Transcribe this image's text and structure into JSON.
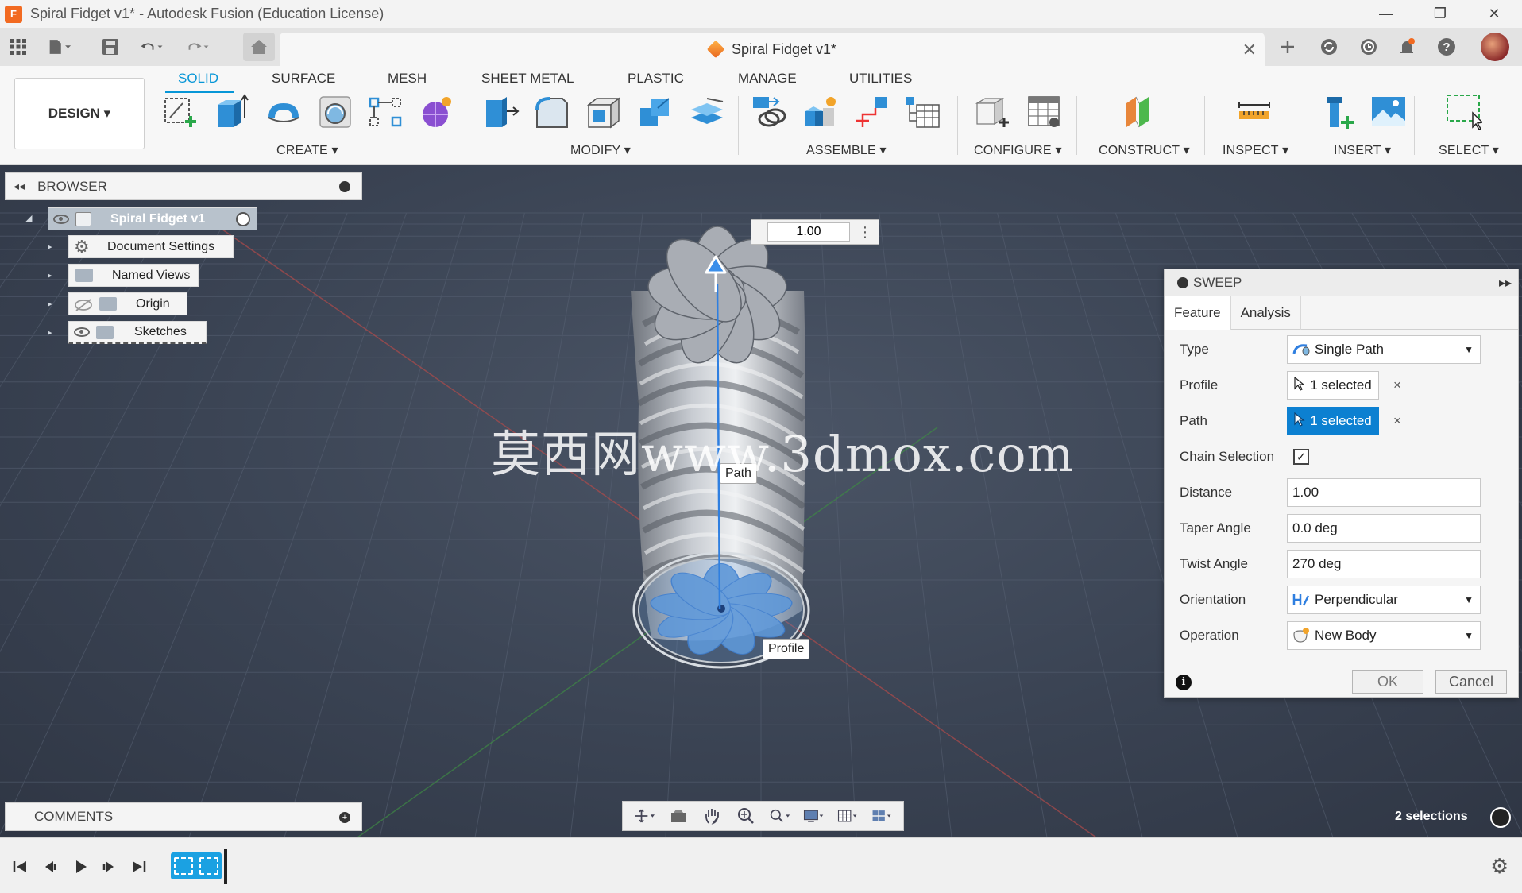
{
  "window": {
    "title": "Spiral Fidget v1* - Autodesk Fusion (Education License)",
    "app_icon": "F",
    "minimize_icon": "—",
    "restore_icon": "❐",
    "close_icon": "✕"
  },
  "doc_tab": {
    "label": "Spiral Fidget v1*",
    "close": "✕"
  },
  "workspace": {
    "label": "DESIGN ▾"
  },
  "ribbon_tabs": [
    "SOLID",
    "SURFACE",
    "MESH",
    "SHEET METAL",
    "PLASTIC",
    "MANAGE",
    "UTILITIES"
  ],
  "ribbon_groups": {
    "create": "CREATE ▾",
    "modify": "MODIFY ▾",
    "assemble": "ASSEMBLE ▾",
    "configure": "CONFIGURE ▾",
    "construct": "CONSTRUCT ▾",
    "inspect": "INSPECT ▾",
    "insert": "INSERT ▾",
    "select": "SELECT ▾"
  },
  "browser": {
    "title": "BROWSER",
    "collapse_icon": "◂◂",
    "root": "Spiral Fidget v1",
    "items": [
      "Document Settings",
      "Named Views",
      "Origin",
      "Sketches"
    ]
  },
  "comments": {
    "title": "COMMENTS",
    "plus": "+"
  },
  "viewport": {
    "dimension_value": "1.00",
    "path_label": "Path",
    "profile_label": "Profile",
    "watermark": "莫西网www.3dmox.com"
  },
  "status": {
    "selections": "2 selections"
  },
  "sweep": {
    "title": "SWEEP",
    "expand_icon": "▸▸",
    "tabs": [
      "Feature",
      "Analysis"
    ],
    "rows": {
      "type": {
        "label": "Type",
        "value": "Single Path"
      },
      "profile": {
        "label": "Profile",
        "value": "1 selected"
      },
      "path": {
        "label": "Path",
        "value": "1 selected"
      },
      "chain": {
        "label": "Chain Selection",
        "checked": "✓"
      },
      "distance": {
        "label": "Distance",
        "value": "1.00"
      },
      "taper": {
        "label": "Taper Angle",
        "value": "0.0 deg"
      },
      "twist": {
        "label": "Twist Angle",
        "value": "270 deg"
      },
      "orientation": {
        "label": "Orientation",
        "value": "Perpendicular"
      },
      "operation": {
        "label": "Operation",
        "value": "New Body"
      }
    },
    "clear_icon": "×",
    "ok": "OK",
    "cancel": "Cancel",
    "info_icon": "i"
  },
  "colors": {
    "accent": "#0696d7",
    "active_selection": "#0c80d1",
    "timeline_feature": "#1ba1e2"
  }
}
